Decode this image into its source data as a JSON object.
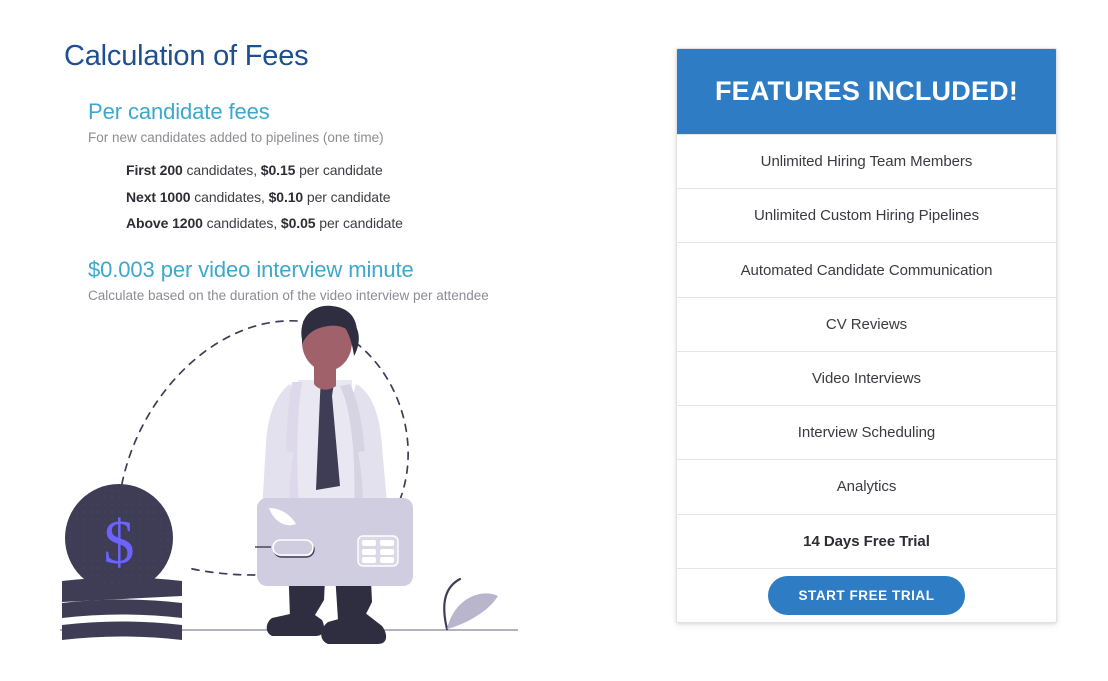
{
  "page": {
    "title": "Calculation of Fees"
  },
  "fees": {
    "candidate_section": {
      "heading": "Per candidate fees",
      "subtext": "For new candidates added to pipelines (one time)",
      "tiers": [
        {
          "qualifier": "First 200",
          "middle": " candidates, ",
          "price": "$0.15",
          "suffix": " per candidate"
        },
        {
          "qualifier": "Next 1000",
          "middle": " candidates, ",
          "price": "$0.10",
          "suffix": " per candidate"
        },
        {
          "qualifier": "Above 1200",
          "middle": " candidates, ",
          "price": "$0.05",
          "suffix": " per candidate"
        }
      ]
    },
    "video_section": {
      "heading": "$0.003 per video interview minute",
      "subtext": "Calculate based on the duration of the video interview per attendee"
    }
  },
  "illustration": {
    "name": "businessman-carrying-credit-card-with-coin-stack",
    "coin_symbol": "$",
    "elements": [
      "dashed-arc",
      "dollar-coin",
      "coin-stack",
      "businessman",
      "credit-card",
      "plant",
      "ground-line"
    ]
  },
  "features_card": {
    "header": "FEATURES INCLUDED!",
    "rows": [
      {
        "label": "Unlimited Hiring Team Members",
        "bold": false
      },
      {
        "label": "Unlimited Custom Hiring Pipelines",
        "bold": false
      },
      {
        "label": "Automated Candidate Communication",
        "bold": false
      },
      {
        "label": "CV Reviews",
        "bold": false
      },
      {
        "label": "Video Interviews",
        "bold": false
      },
      {
        "label": "Interview Scheduling",
        "bold": false
      },
      {
        "label": "Analytics",
        "bold": false
      },
      {
        "label": "14 Days Free Trial",
        "bold": true
      }
    ],
    "cta_label": "START FREE TRIAL"
  },
  "colors": {
    "title_blue": "#1d4f91",
    "heading_teal": "#3ba8cc",
    "accent_blue": "#2e7cc3",
    "body_text": "#3d3d45",
    "muted_text": "#8c8c94",
    "illustration_dark": "#3f3d56",
    "illustration_periwinkle": "#6c63ff",
    "illustration_lavender": "#d0cde1",
    "illustration_skin": "#a0616a",
    "divider": "#e4e4e6"
  }
}
